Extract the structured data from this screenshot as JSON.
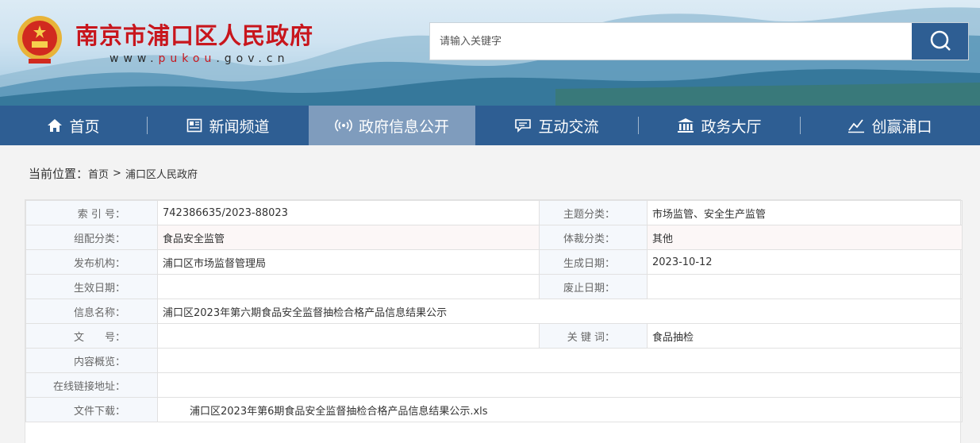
{
  "header": {
    "site_title": "南京市浦口区人民政府",
    "site_url_pre": "www.",
    "site_url_accent": "pukou",
    "site_url_post": ".gov.cn",
    "emblem_icon": "national-emblem-icon",
    "search": {
      "placeholder": "请输入关键字",
      "button_icon": "search-icon"
    }
  },
  "nav": {
    "items": [
      {
        "label": "首页",
        "icon": "home-icon"
      },
      {
        "label": "新闻频道",
        "icon": "news-icon"
      },
      {
        "label": "政府信息公开",
        "icon": "broadcast-icon"
      },
      {
        "label": "互动交流",
        "icon": "chat-icon"
      },
      {
        "label": "政务大厅",
        "icon": "building-icon"
      },
      {
        "label": "创赢浦口",
        "icon": "chart-icon"
      }
    ],
    "active_index": 2
  },
  "breadcrumb": {
    "label": "当前位置：",
    "items": [
      "首页",
      "浦口区人民政府"
    ],
    "separator": ">"
  },
  "meta_table": {
    "index_no_label": "索 引 号：",
    "index_no": "742386635/2023-88023",
    "topic_label": "主题分类：",
    "topic": "市场监管、安全生产监管",
    "group_label": "组配分类：",
    "group": "食品安全监管",
    "genre_label": "体裁分类：",
    "genre": "其他",
    "publisher_label": "发布机构：",
    "publisher": "浦口区市场监督管理局",
    "created_label": "生成日期：",
    "created": "2023-10-12",
    "effective_label": "生效日期：",
    "effective": "",
    "abolished_label": "废止日期：",
    "abolished": "",
    "info_name_label": "信息名称：",
    "info_name": "浦口区2023年第六期食品安全监督抽检合格产品信息结果公示",
    "doc_no_label": "文　　号：",
    "doc_no": "",
    "keywords_label": "关 键 词：",
    "keywords": "食品抽检",
    "summary_label": "内容概览：",
    "summary": "",
    "online_link_label": "在线链接地址：",
    "online_link": "",
    "download_label": "文件下载：",
    "download_file": "浦口区2023年第6期食品安全监督抽检合格产品信息结果公示.xls"
  },
  "colors": {
    "brand_red": "#c8161d",
    "nav_blue": "#2e5e93",
    "nav_active": "#7f9cbd"
  }
}
